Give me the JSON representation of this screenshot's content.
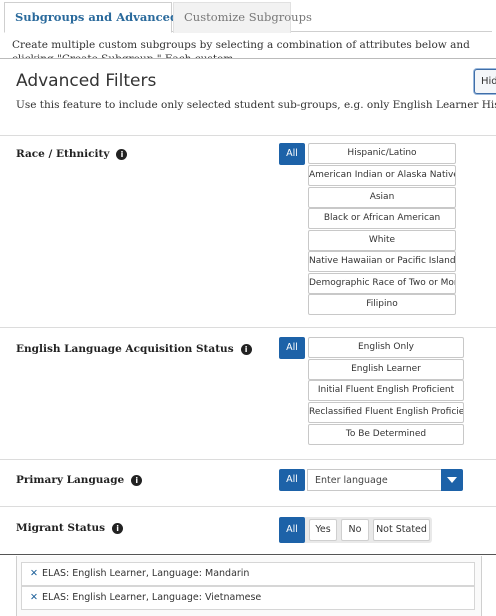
{
  "background": {
    "tabs": [
      {
        "label": "Subgroups and Advanced Filters",
        "active": true
      },
      {
        "label": "Customize Subgroups",
        "active": false
      }
    ],
    "intro_line1": "Create multiple custom subgroups by selecting a combination of attributes below and clicking \"Create Subgroup.\" Each custom",
    "selected_filters": [
      "ELAS: English Learner, Language: Mandarin",
      "ELAS: English Learner, Language: Vietnamese"
    ]
  },
  "modal": {
    "title": "Advanced Filters",
    "hide_label": "Hide",
    "description": "Use this feature to include only selected student sub-groups, e.g. only English Learner Hispanic students.",
    "all_label": "All",
    "race": {
      "label": "Race / Ethnicity",
      "options": [
        "Hispanic/Latino",
        "American Indian or Alaska Native",
        "Asian",
        "Black or African American",
        "White",
        "Native Hawaiian or Pacific Islander",
        "Demographic Race of Two or More",
        "Filipino"
      ]
    },
    "elas": {
      "label": "English Language Acquisition Status",
      "options": [
        "English Only",
        "English Learner",
        "Initial Fluent English Proficient",
        "Reclassified Fluent English Proficient",
        "To Be Determined"
      ]
    },
    "language": {
      "label": "Primary Language",
      "placeholder": "Enter language"
    },
    "migrant": {
      "label": "Migrant Status",
      "options": [
        "Yes",
        "No",
        "Not Stated"
      ]
    }
  },
  "colors": {
    "primary_button": "#1d62a8",
    "tab_active_text": "#2a6a9c",
    "remove_icon": "#1b5f99"
  }
}
